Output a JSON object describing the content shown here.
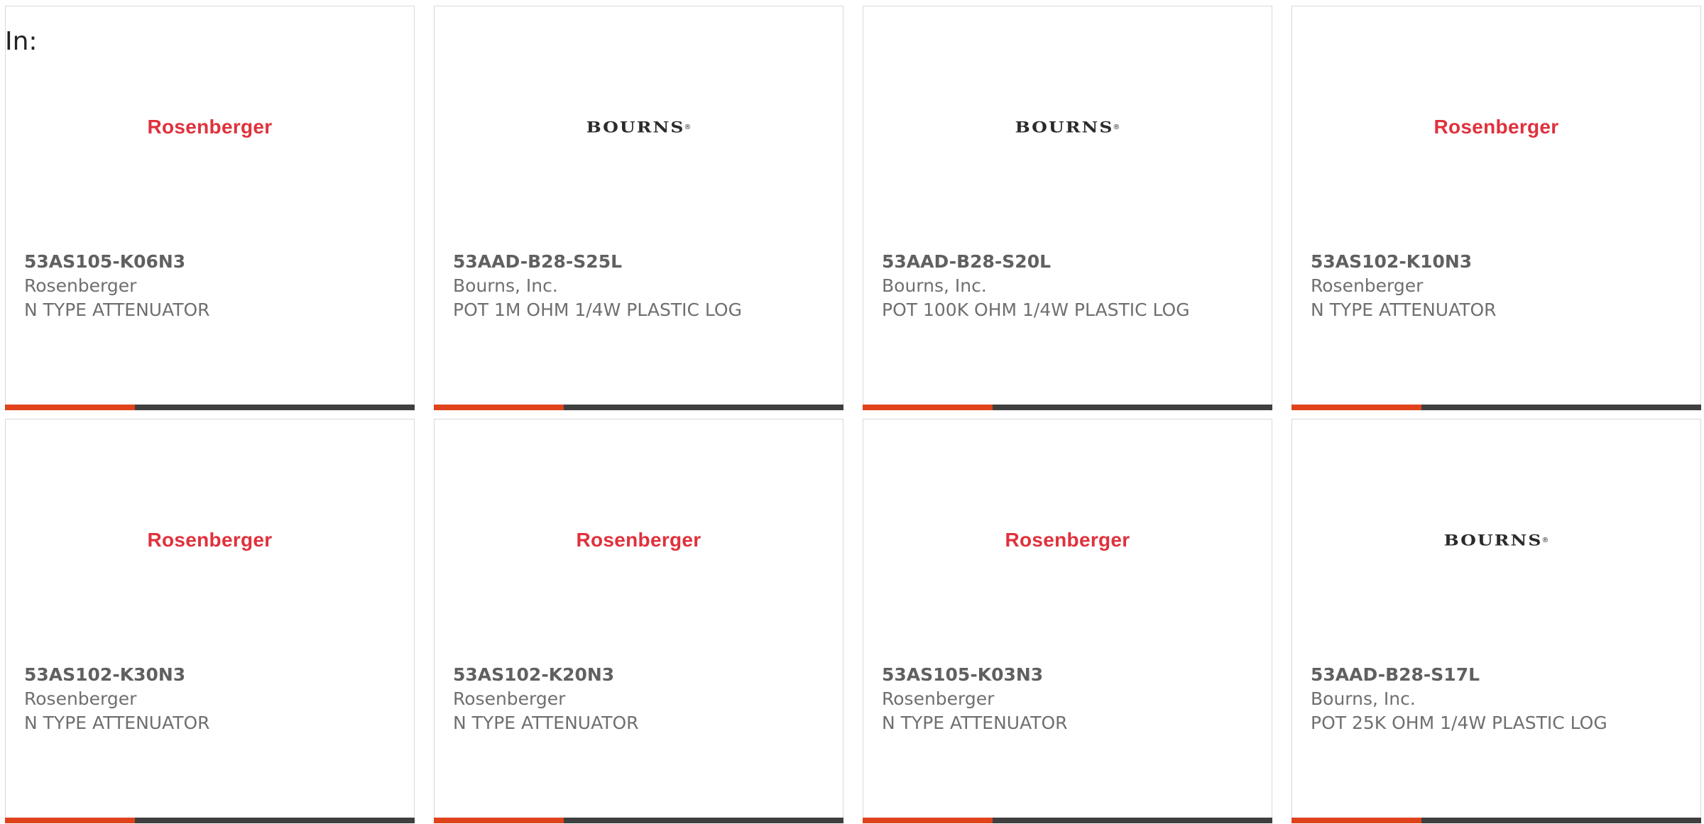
{
  "header": {
    "in_label": "In:"
  },
  "colors": {
    "accent": "#e0431c",
    "bar": "#3f3f3f",
    "rosenberger_red": "#e0313c",
    "border": "#d9d9d9"
  },
  "cards": [
    {
      "logo": "Rosenberger",
      "logo_type": "rosenberger",
      "part": "53AS105-K06N3",
      "manufacturer": "Rosenberger",
      "description": "N TYPE ATTENUATOR"
    },
    {
      "logo": "BOURNS",
      "logo_type": "bourns",
      "part": "53AAD-B28-S25L",
      "manufacturer": "Bourns, Inc.",
      "description": "POT 1M OHM 1/4W PLASTIC LOG"
    },
    {
      "logo": "BOURNS",
      "logo_type": "bourns",
      "part": "53AAD-B28-S20L",
      "manufacturer": "Bourns, Inc.",
      "description": "POT 100K OHM 1/4W PLASTIC LOG"
    },
    {
      "logo": "Rosenberger",
      "logo_type": "rosenberger",
      "part": "53AS102-K10N3",
      "manufacturer": "Rosenberger",
      "description": "N TYPE ATTENUATOR"
    },
    {
      "logo": "Rosenberger",
      "logo_type": "rosenberger",
      "part": "53AS102-K30N3",
      "manufacturer": "Rosenberger",
      "description": "N TYPE ATTENUATOR"
    },
    {
      "logo": "Rosenberger",
      "logo_type": "rosenberger",
      "part": "53AS102-K20N3",
      "manufacturer": "Rosenberger",
      "description": "N TYPE ATTENUATOR"
    },
    {
      "logo": "Rosenberger",
      "logo_type": "rosenberger",
      "part": "53AS105-K03N3",
      "manufacturer": "Rosenberger",
      "description": "N TYPE ATTENUATOR"
    },
    {
      "logo": "BOURNS",
      "logo_type": "bourns",
      "part": "53AAD-B28-S17L",
      "manufacturer": "Bourns, Inc.",
      "description": "POT 25K OHM 1/4W PLASTIC LOG"
    }
  ]
}
